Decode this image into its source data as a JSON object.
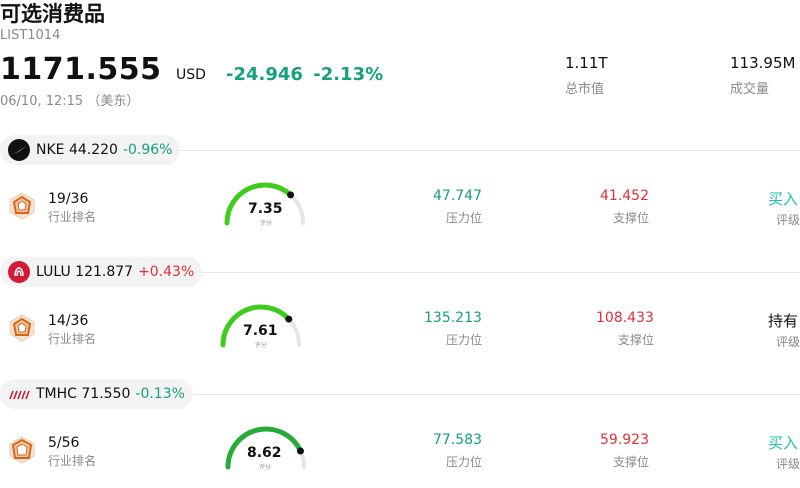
{
  "header": {
    "title": "可选消费品",
    "code": "LIST1014",
    "price": "1171.555",
    "currency": "USD",
    "change": "-24.946",
    "change_pct": "-2.13%",
    "time": "06/10, 12:15 （美东）",
    "market_cap_value": "1.11T",
    "market_cap_label": "总市值",
    "volume_value": "113.95M",
    "volume_label": "成交量"
  },
  "colors": {
    "down": "#15a07e",
    "up": "#e0303a",
    "buy": "#1cc4a8",
    "gauge": "#3ecc1e"
  },
  "stocks": [
    {
      "symbol": "NKE",
      "price": "44.220",
      "change_pct": "-0.96%",
      "logo_icon": "nike-swoosh-icon",
      "rank": "19/36",
      "rank_label": "行业排名",
      "score": "7.35",
      "score_label": "评分",
      "score_fraction": 0.735,
      "resistance": "47.747",
      "resistance_label": "压力位",
      "support": "41.452",
      "support_label": "支撑位",
      "rating": "买入",
      "rating_label": "评级"
    },
    {
      "symbol": "LULU",
      "price": "121.877",
      "change_pct": "+0.43%",
      "logo_icon": "lululemon-icon",
      "rank": "14/36",
      "rank_label": "行业排名",
      "score": "7.61",
      "score_label": "评分",
      "score_fraction": 0.761,
      "resistance": "135.213",
      "resistance_label": "压力位",
      "support": "108.433",
      "support_label": "支撑位",
      "rating": "持有",
      "rating_label": "评级"
    },
    {
      "symbol": "TMHC",
      "price": "71.550",
      "change_pct": "-0.13%",
      "logo_icon": "tmhc-logo-icon",
      "rank": "5/56",
      "rank_label": "行业排名",
      "score": "8.62",
      "score_label": "评分",
      "score_fraction": 0.862,
      "resistance": "77.583",
      "resistance_label": "压力位",
      "support": "59.923",
      "support_label": "支撑位",
      "rating": "买入",
      "rating_label": "评级"
    }
  ]
}
